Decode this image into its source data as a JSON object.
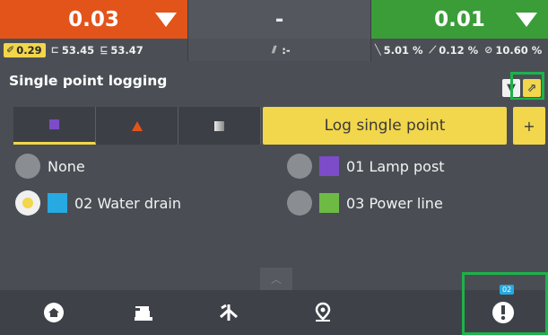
{
  "top": {
    "left": {
      "value": "0.03",
      "chip_value": "0.29",
      "stat2": "53.45",
      "stat3": "53.47",
      "color": "#e2541a"
    },
    "middle": {
      "value": "-",
      "stat": ":-"
    },
    "right": {
      "value": "0.01",
      "stat1": "5.01 %",
      "stat2": "0.12 %",
      "stat3": "10.60 %",
      "color": "#3a9d38"
    }
  },
  "header": {
    "title": "Single point logging",
    "filter_icon": "filter-icon",
    "external_icon": "external-link-icon"
  },
  "toolbar": {
    "log_label": "Log single point",
    "add_label": "+"
  },
  "options": [
    {
      "label": "None",
      "selected": false,
      "color": null
    },
    {
      "label": "01 Lamp post",
      "selected": false,
      "color": "#7c4cc9"
    },
    {
      "label": "02 Water drain",
      "selected": true,
      "color": "#27a9e1"
    },
    {
      "label": "03 Power line",
      "selected": false,
      "color": "#6dbb45"
    }
  ],
  "nav": {
    "items": [
      "home-icon",
      "machine-icon",
      "survey-icon",
      "location-pin-icon",
      "point-log-icon"
    ],
    "badge": "02"
  },
  "colors": {
    "accent": "#f2d64b",
    "highlight": "#1db24a"
  }
}
